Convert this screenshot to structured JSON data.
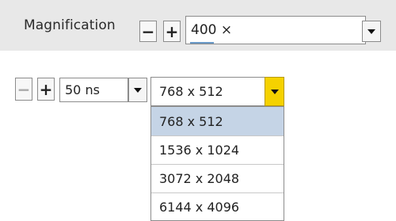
{
  "magnification": {
    "label": "Magnification",
    "minus_label": "−",
    "plus_label": "+",
    "value": "400 ×",
    "dropdown_icon": "chevron-down-icon"
  },
  "dwell": {
    "minus_label": "−",
    "plus_label": "+",
    "value": "50 ns",
    "dropdown_icon": "chevron-down-icon"
  },
  "resolution": {
    "value": "768 x 512",
    "dropdown_icon": "chevron-down-icon",
    "arrow_color": "#f5d200",
    "options": [
      "768 x 512",
      "1536 x 1024",
      "3072 x 2048",
      "6144 x 4096"
    ],
    "selected_index": 0
  }
}
